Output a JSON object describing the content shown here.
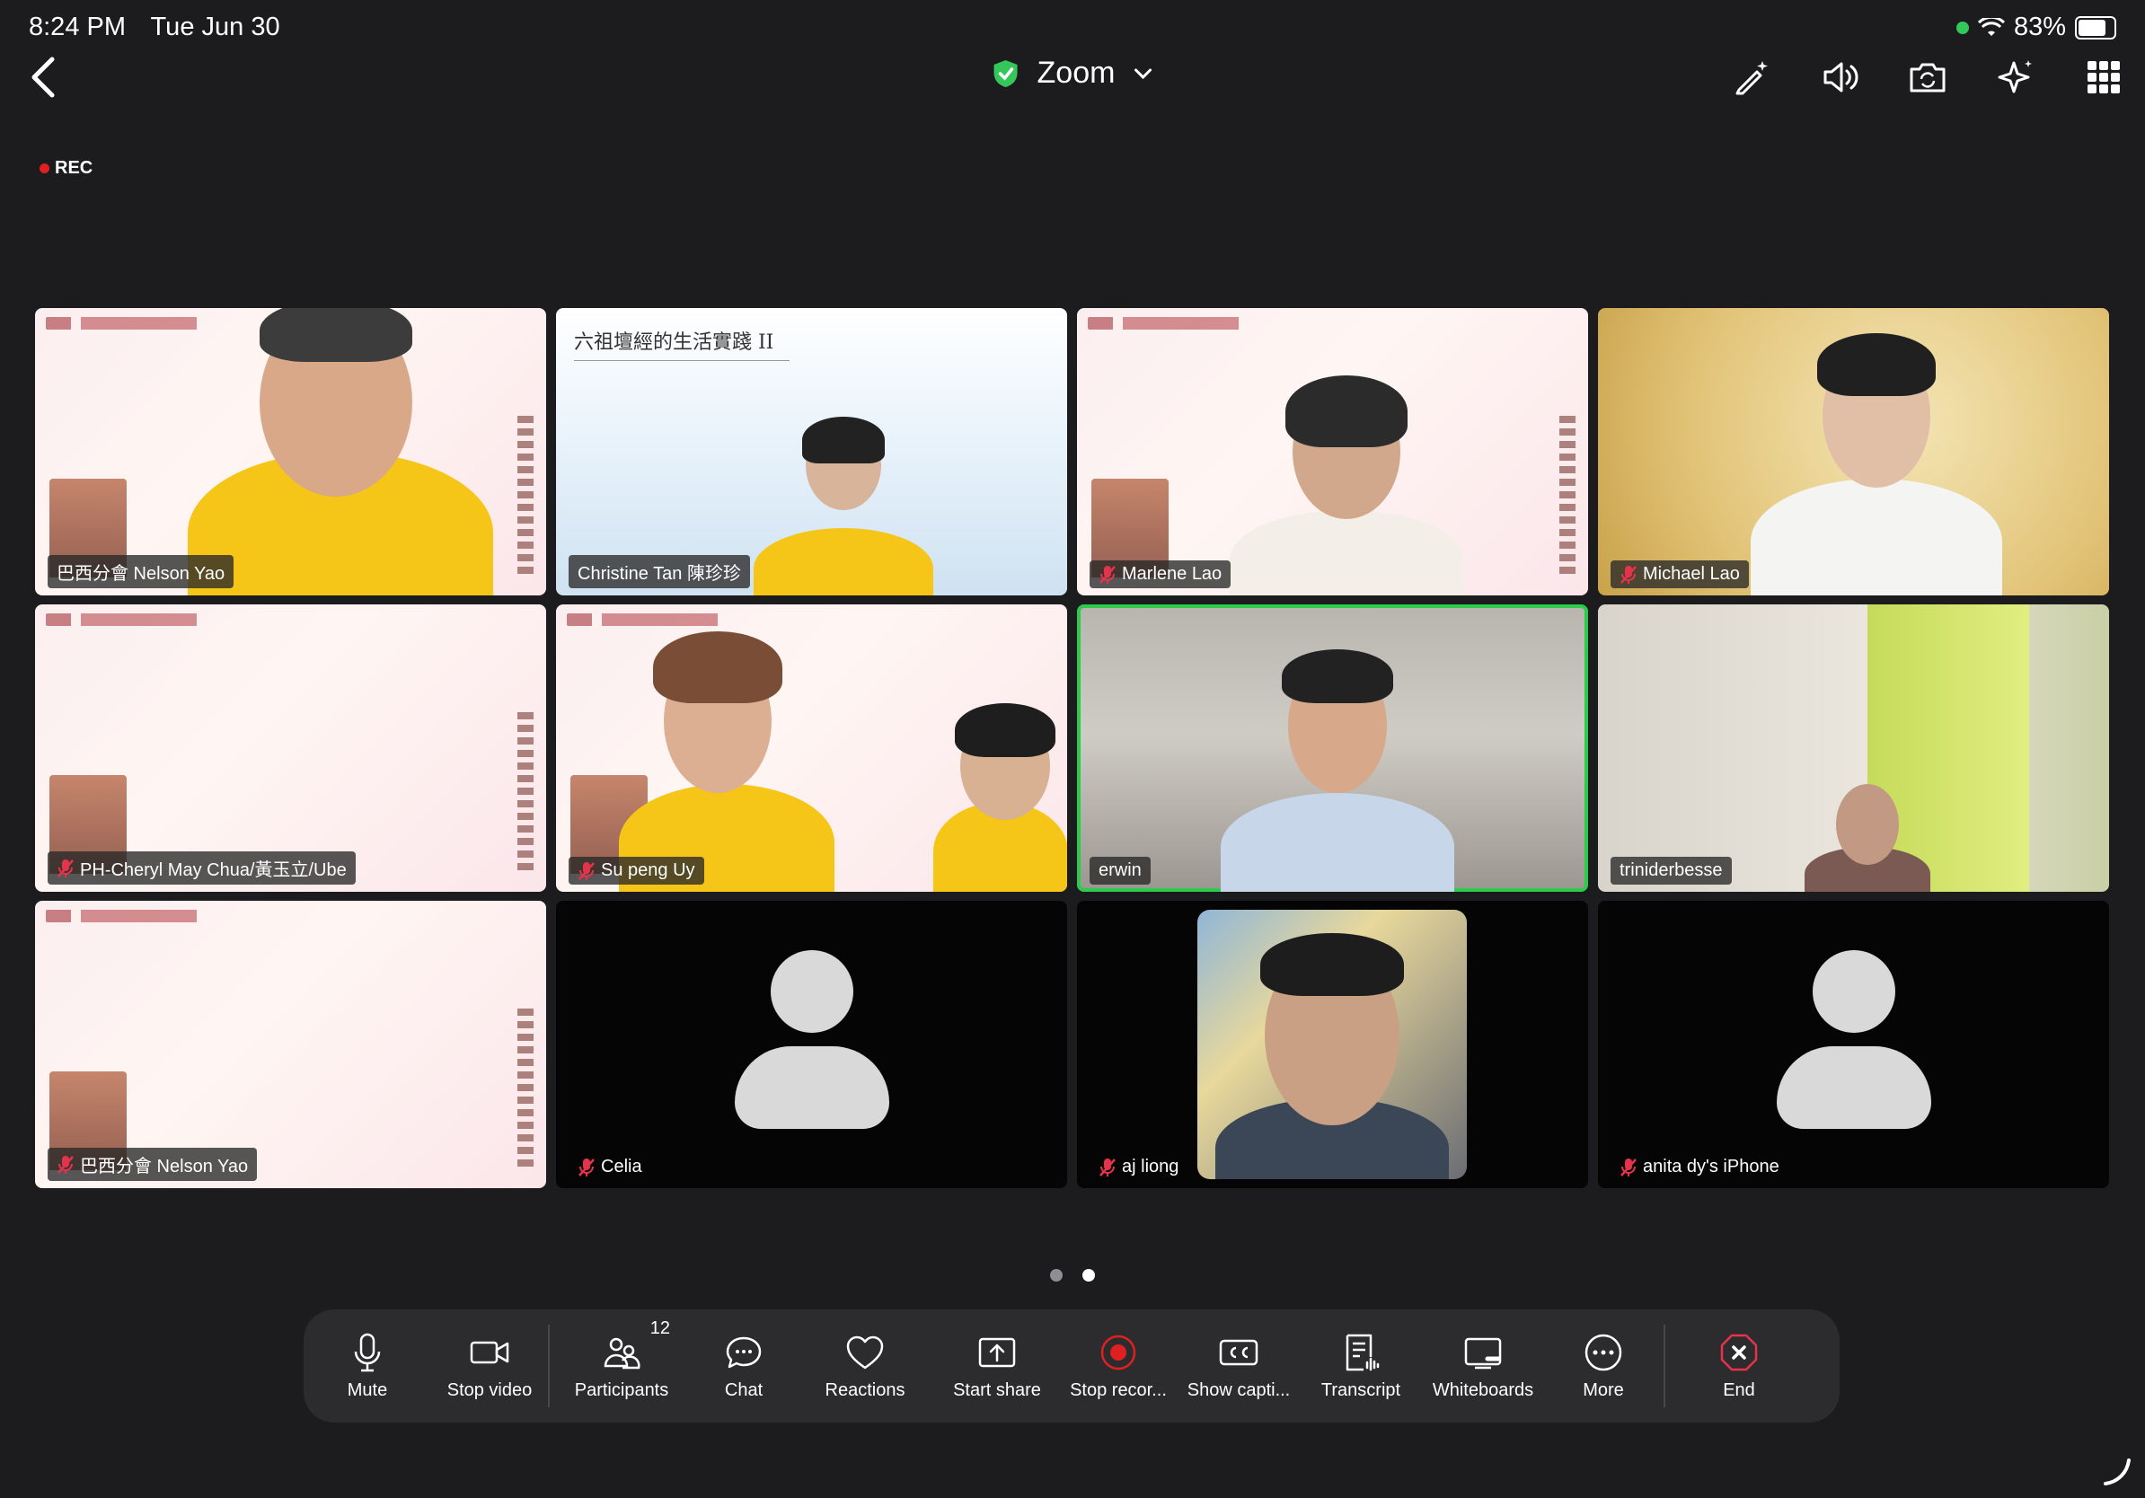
{
  "status_bar": {
    "time": "8:24 PM",
    "date": "Tue Jun 30",
    "battery": "83%",
    "battery_level": 0.83
  },
  "header": {
    "title": "Zoom"
  },
  "recording": {
    "label": "REC"
  },
  "tiles": [
    {
      "name": "巴西分會 Nelson Yao",
      "muted": false
    },
    {
      "name": "Christine Tan 陳珍珍",
      "muted": false,
      "slide_title": "六祖壇經的生活實踐 II"
    },
    {
      "name": "Marlene Lao",
      "muted": true
    },
    {
      "name": "Michael Lao",
      "muted": true
    },
    {
      "name": "PH-Cheryl May Chua/黃玉立/Ube",
      "muted": true
    },
    {
      "name": "Su peng Uy",
      "muted": true
    },
    {
      "name": "erwin",
      "muted": false,
      "active_speaker": true
    },
    {
      "name": "triniderbesse",
      "muted": false
    },
    {
      "name": "巴西分會 Nelson Yao",
      "muted": true
    },
    {
      "name": "Celia",
      "muted": true
    },
    {
      "name": "aj liong",
      "muted": true
    },
    {
      "name": "anita dy's iPhone",
      "muted": true
    }
  ],
  "pager": {
    "pages": 2,
    "current": 2
  },
  "toolbar": {
    "mute": "Mute",
    "stop_video": "Stop video",
    "participants": "Participants",
    "participants_count": "12",
    "chat": "Chat",
    "reactions": "Reactions",
    "start_share": "Start share",
    "stop_recording": "Stop recor...",
    "show_captions": "Show capti...",
    "transcript": "Transcript",
    "whiteboards": "Whiteboards",
    "more": "More",
    "end": "End"
  },
  "colors": {
    "active_border": "#2ccb4b",
    "record_red": "#e02020",
    "end_red": "#e5334b",
    "shield_green": "#34c759"
  }
}
